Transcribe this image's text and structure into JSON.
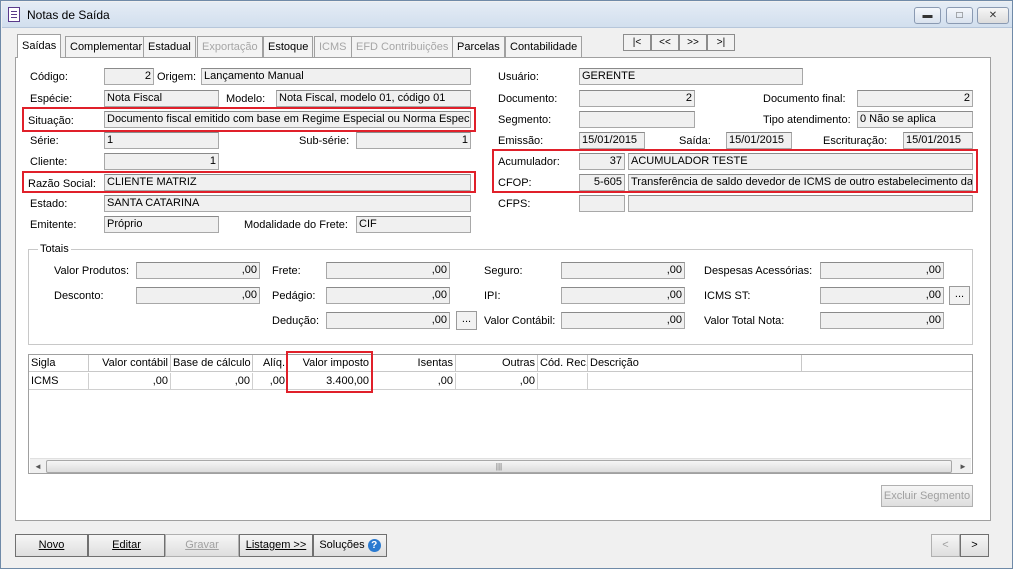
{
  "window": {
    "title": "Notas de Saída",
    "minimize": "▬",
    "maximize": "□",
    "close": "✕"
  },
  "tabs": [
    {
      "label": "Saídas"
    },
    {
      "label": "Complementar"
    },
    {
      "label": "Estadual"
    },
    {
      "label": "Exportação"
    },
    {
      "label": "Estoque"
    },
    {
      "label": "ICMS"
    },
    {
      "label": "EFD Contribuições"
    },
    {
      "label": "Parcelas"
    },
    {
      "label": "Contabilidade"
    }
  ],
  "nav": {
    "first": "|<",
    "prev": "<<",
    "next": ">>",
    "last": ">|"
  },
  "form": {
    "codigo_label": "Código:",
    "codigo": "2",
    "origem_label": "Origem:",
    "origem": "Lançamento Manual",
    "especie_label": "Espécie:",
    "especie": "Nota Fiscal",
    "modelo_label": "Modelo:",
    "modelo": "Nota Fiscal, modelo 01, código 01",
    "situacao_label": "Situação:",
    "situacao": "Documento fiscal emitido com base em Regime Especial ou Norma Específic",
    "serie_label": "Série:",
    "serie": "1",
    "subserie_label": "Sub-série:",
    "subserie": "1",
    "cliente_label": "Cliente:",
    "cliente": "1",
    "razao_label": "Razão Social:",
    "razao": "CLIENTE MATRIZ",
    "estado_label": "Estado:",
    "estado": "SANTA CATARINA",
    "emitente_label": "Emitente:",
    "emitente": "Próprio",
    "frete_label": "Modalidade do Frete:",
    "frete": "CIF",
    "usuario_label": "Usuário:",
    "usuario": "GERENTE",
    "documento_label": "Documento:",
    "documento": "2",
    "docfinal_label": "Documento final:",
    "docfinal": "2",
    "segmento_label": "Segmento:",
    "segmento": "",
    "tipoatend_label": "Tipo atendimento:",
    "tipoatend": "0 Não se aplica",
    "emissao_label": "Emissão:",
    "emissao": "15/01/2015",
    "saida_label": "Saída:",
    "saida": "15/01/2015",
    "escrituracao_label": "Escrituração:",
    "escrituracao": "15/01/2015",
    "acumulador_label": "Acumulador:",
    "acumulador_cod": "37",
    "acumulador": "ACUMULADOR TESTE",
    "cfop_label": "CFOP:",
    "cfop_cod": "5-605",
    "cfop": "Transferência de saldo devedor de ICMS de outro estabelecimento da m",
    "cfps_label": "CFPS:",
    "cfps_cod": "",
    "cfps": ""
  },
  "totais": {
    "label": "Totais",
    "valor_produtos_label": "Valor Produtos:",
    "valor_produtos": ",00",
    "desconto_label": "Desconto:",
    "desconto": ",00",
    "frete_label": "Frete:",
    "frete": ",00",
    "pedagio_label": "Pedágio:",
    "pedagio": ",00",
    "deducao_label": "Dedução:",
    "deducao": ",00",
    "seguro_label": "Seguro:",
    "seguro": ",00",
    "ipi_label": "IPI:",
    "ipi": ",00",
    "valor_contabil_label": "Valor Contábil:",
    "valor_contabil": ",00",
    "desp_label": "Despesas Acessórias:",
    "desp": ",00",
    "icmsst_label": "ICMS ST:",
    "icmsst": ",00",
    "total_label": "Valor Total Nota:",
    "total": ",00",
    "ellipsis": "..."
  },
  "grid": {
    "headers": [
      "Sigla",
      "Valor contábil",
      "Base de cálculo",
      "Alíq.",
      "Valor imposto",
      "Isentas",
      "Outras",
      "Cód. Rec.",
      "Descrição"
    ],
    "rows": [
      [
        "ICMS",
        ",00",
        ",00",
        ",00",
        "3.400,00",
        ",00",
        ",00",
        "",
        ""
      ]
    ],
    "scroll_left": "◄",
    "scroll_right": "►",
    "thumb_grip": "|||"
  },
  "buttons": {
    "excluir_segmento": "Excluir Segmento",
    "novo": "Novo",
    "editar": "Editar",
    "gravar": "Gravar",
    "listagem": "Listagem >>",
    "solucoes": "Soluções",
    "help_icon": "?",
    "prev": "<",
    "next": ">"
  },
  "highlight_color": "#e0202a"
}
